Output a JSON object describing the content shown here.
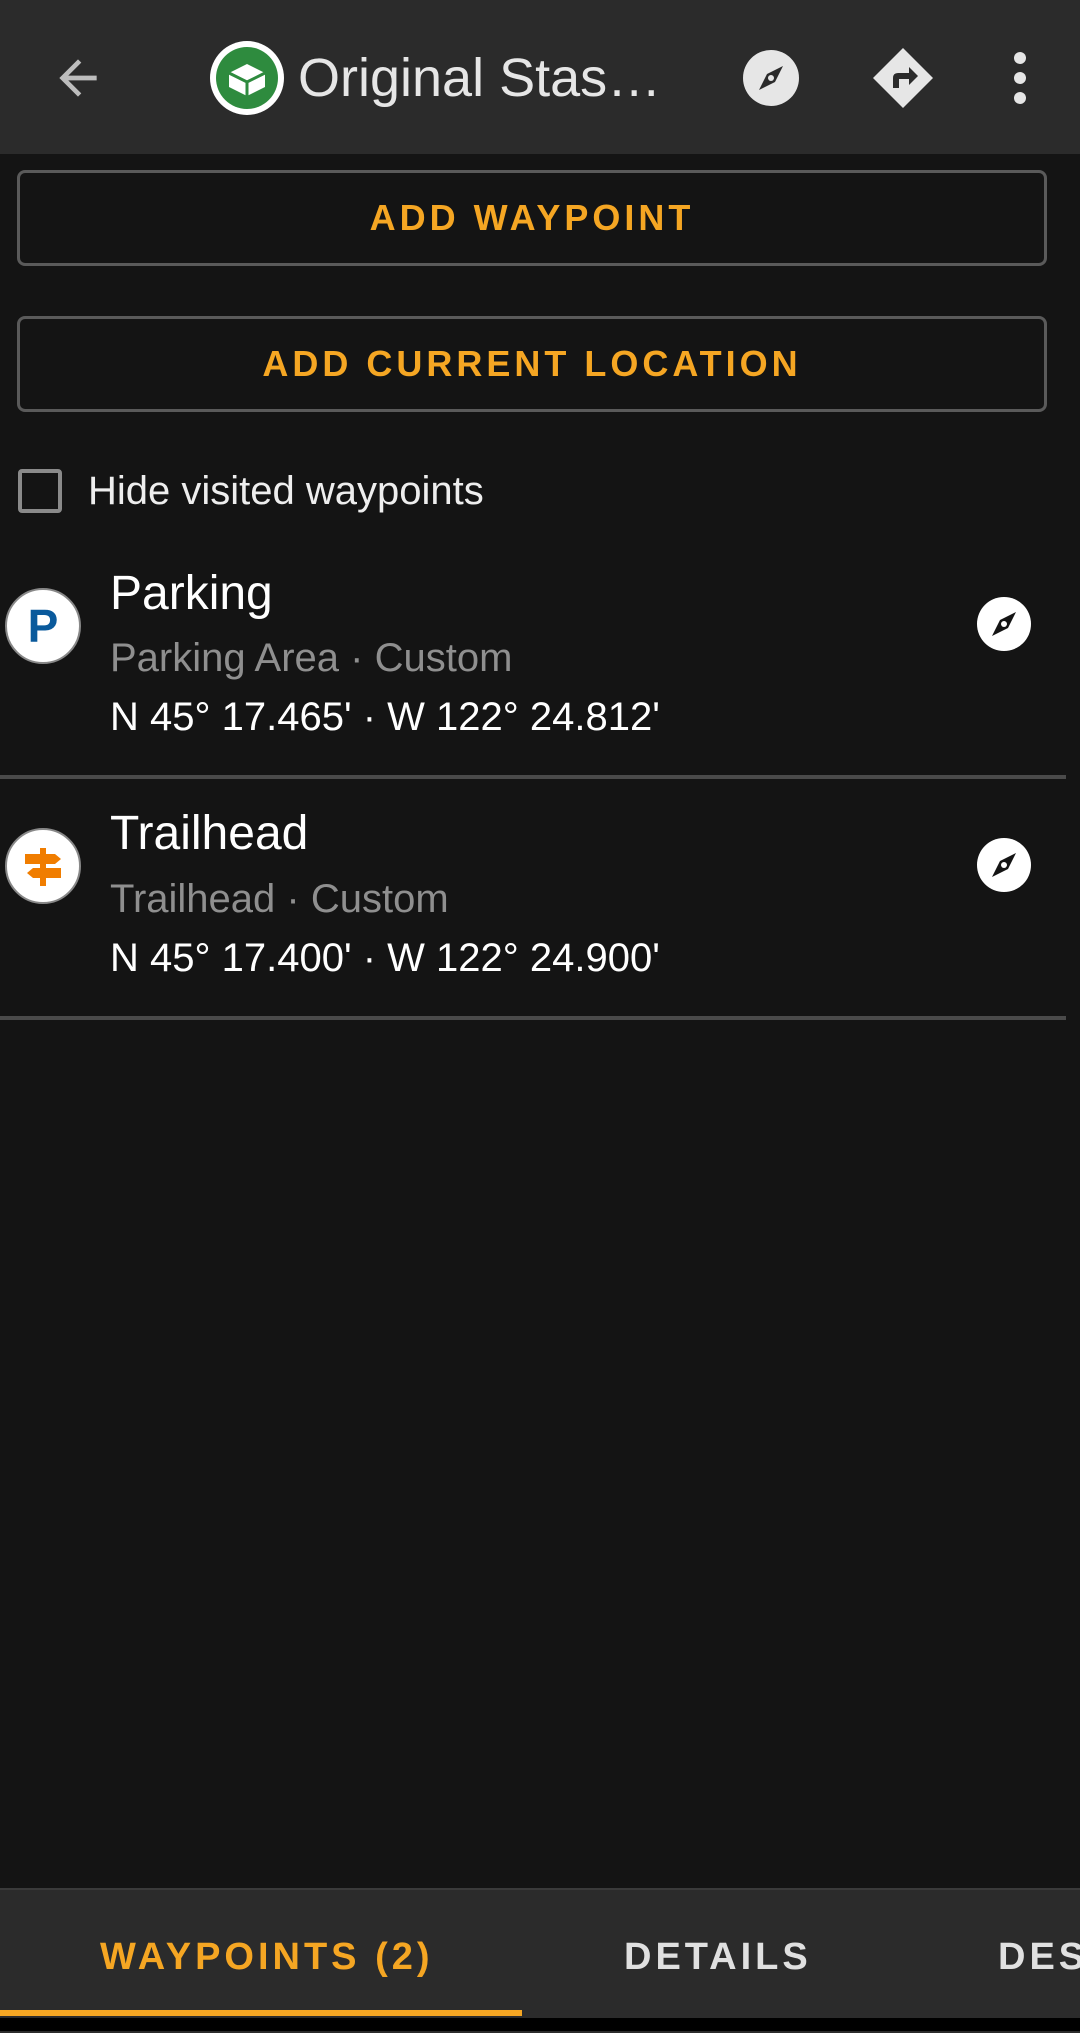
{
  "header": {
    "title": "Original Stash…",
    "back_icon": "arrow-back-icon",
    "cache_icon": "traditional-cache-icon",
    "actions": [
      "compass-icon",
      "directions-icon",
      "more-vert-icon"
    ]
  },
  "buttons": {
    "add_waypoint": "ADD WAYPOINT",
    "add_current_location": "ADD CURRENT LOCATION"
  },
  "filter": {
    "label": "Hide visited waypoints",
    "checked": false
  },
  "waypoints": [
    {
      "name": "Parking",
      "subtitle": "Parking Area · Custom",
      "coords": "N 45° 17.465' · W 122° 24.812'",
      "icon": "parking-icon",
      "icon_letter": "P"
    },
    {
      "name": "Trailhead",
      "subtitle": "Trailhead · Custom",
      "coords": "N 45° 17.400' · W 122° 24.900'",
      "icon": "signpost-icon"
    }
  ],
  "tabs": [
    {
      "label": "WAYPOINTS (2)",
      "active": true
    },
    {
      "label": "DETAILS",
      "active": false
    },
    {
      "label": "DES",
      "active": false
    }
  ],
  "colors": {
    "accent": "#f5a623",
    "background": "#141414",
    "appbar": "#2b2b2b",
    "parking_blue": "#0a5a9c",
    "trailhead_orange": "#f07d00",
    "cache_green": "#2e8b3e"
  }
}
